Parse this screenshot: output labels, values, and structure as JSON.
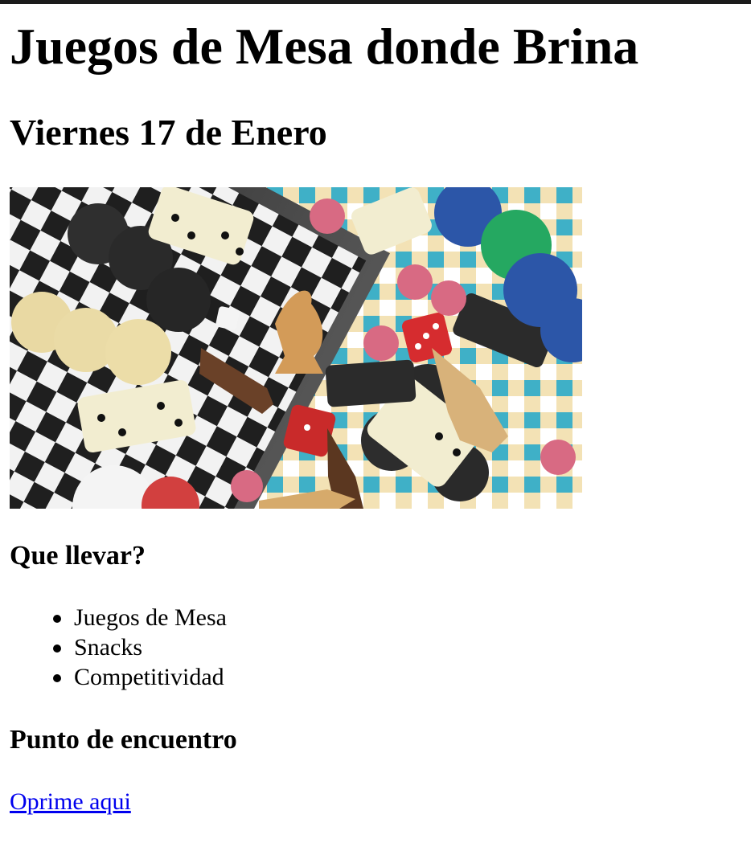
{
  "page": {
    "title": "Juegos de Mesa donde Brina",
    "date": "Viernes 17 de Enero"
  },
  "hero_image": {
    "icon": "board-games-photo"
  },
  "sections": {
    "bring": {
      "title": "Que llevar?",
      "items": [
        "Juegos de Mesa",
        "Snacks",
        "Competitividad"
      ]
    },
    "meeting": {
      "title": "Punto de encuentro",
      "link_label": "Oprime aqui"
    }
  },
  "colors": {
    "link": "#0000ee",
    "topbar": "#1b1b1b"
  }
}
